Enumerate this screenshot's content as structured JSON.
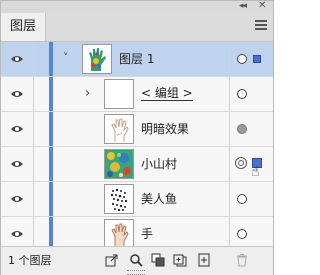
{
  "panel": {
    "tab_label": "图层",
    "collapse_glyph": "◂◂",
    "close_glyph": "✕",
    "menu_icon": "hamburger-menu-icon"
  },
  "layers": [
    {
      "name": "图层 1",
      "indent": 0,
      "expander": "˅",
      "thumb": "hand-green-art",
      "selected": true,
      "target": "hollow",
      "selection_square": true,
      "underline": false
    },
    {
      "name": "< 编组 >",
      "indent": 1,
      "expander": "›",
      "thumb": "blank",
      "selected": false,
      "target": "hollow",
      "selection_square": false,
      "underline": true
    },
    {
      "name": "明暗效果",
      "indent": 1,
      "expander": "",
      "thumb": "hand-sketch",
      "selected": false,
      "target": "filled",
      "selection_square": false,
      "underline": false
    },
    {
      "name": "小山村",
      "indent": 1,
      "expander": "",
      "thumb": "village-pattern",
      "selected": false,
      "target": "double",
      "selection_square": true,
      "underline": false
    },
    {
      "name": "美人鱼",
      "indent": 1,
      "expander": "",
      "thumb": "mermaid-pattern",
      "selected": false,
      "target": "hollow",
      "selection_square": false,
      "underline": false
    },
    {
      "name": "手",
      "indent": 1,
      "expander": "",
      "thumb": "hand-outline",
      "selected": false,
      "target": "hollow",
      "selection_square": false,
      "underline": false
    }
  ],
  "footer": {
    "layer_count": "1 个图层",
    "tools": [
      "export-icon",
      "search-icon",
      "clipping-mask-icon",
      "new-sublayer-icon",
      "new-layer-icon",
      "delete-icon"
    ]
  },
  "colors": {
    "selection_blue": "#bfd3ee",
    "layer_color": "#5a84d6"
  }
}
